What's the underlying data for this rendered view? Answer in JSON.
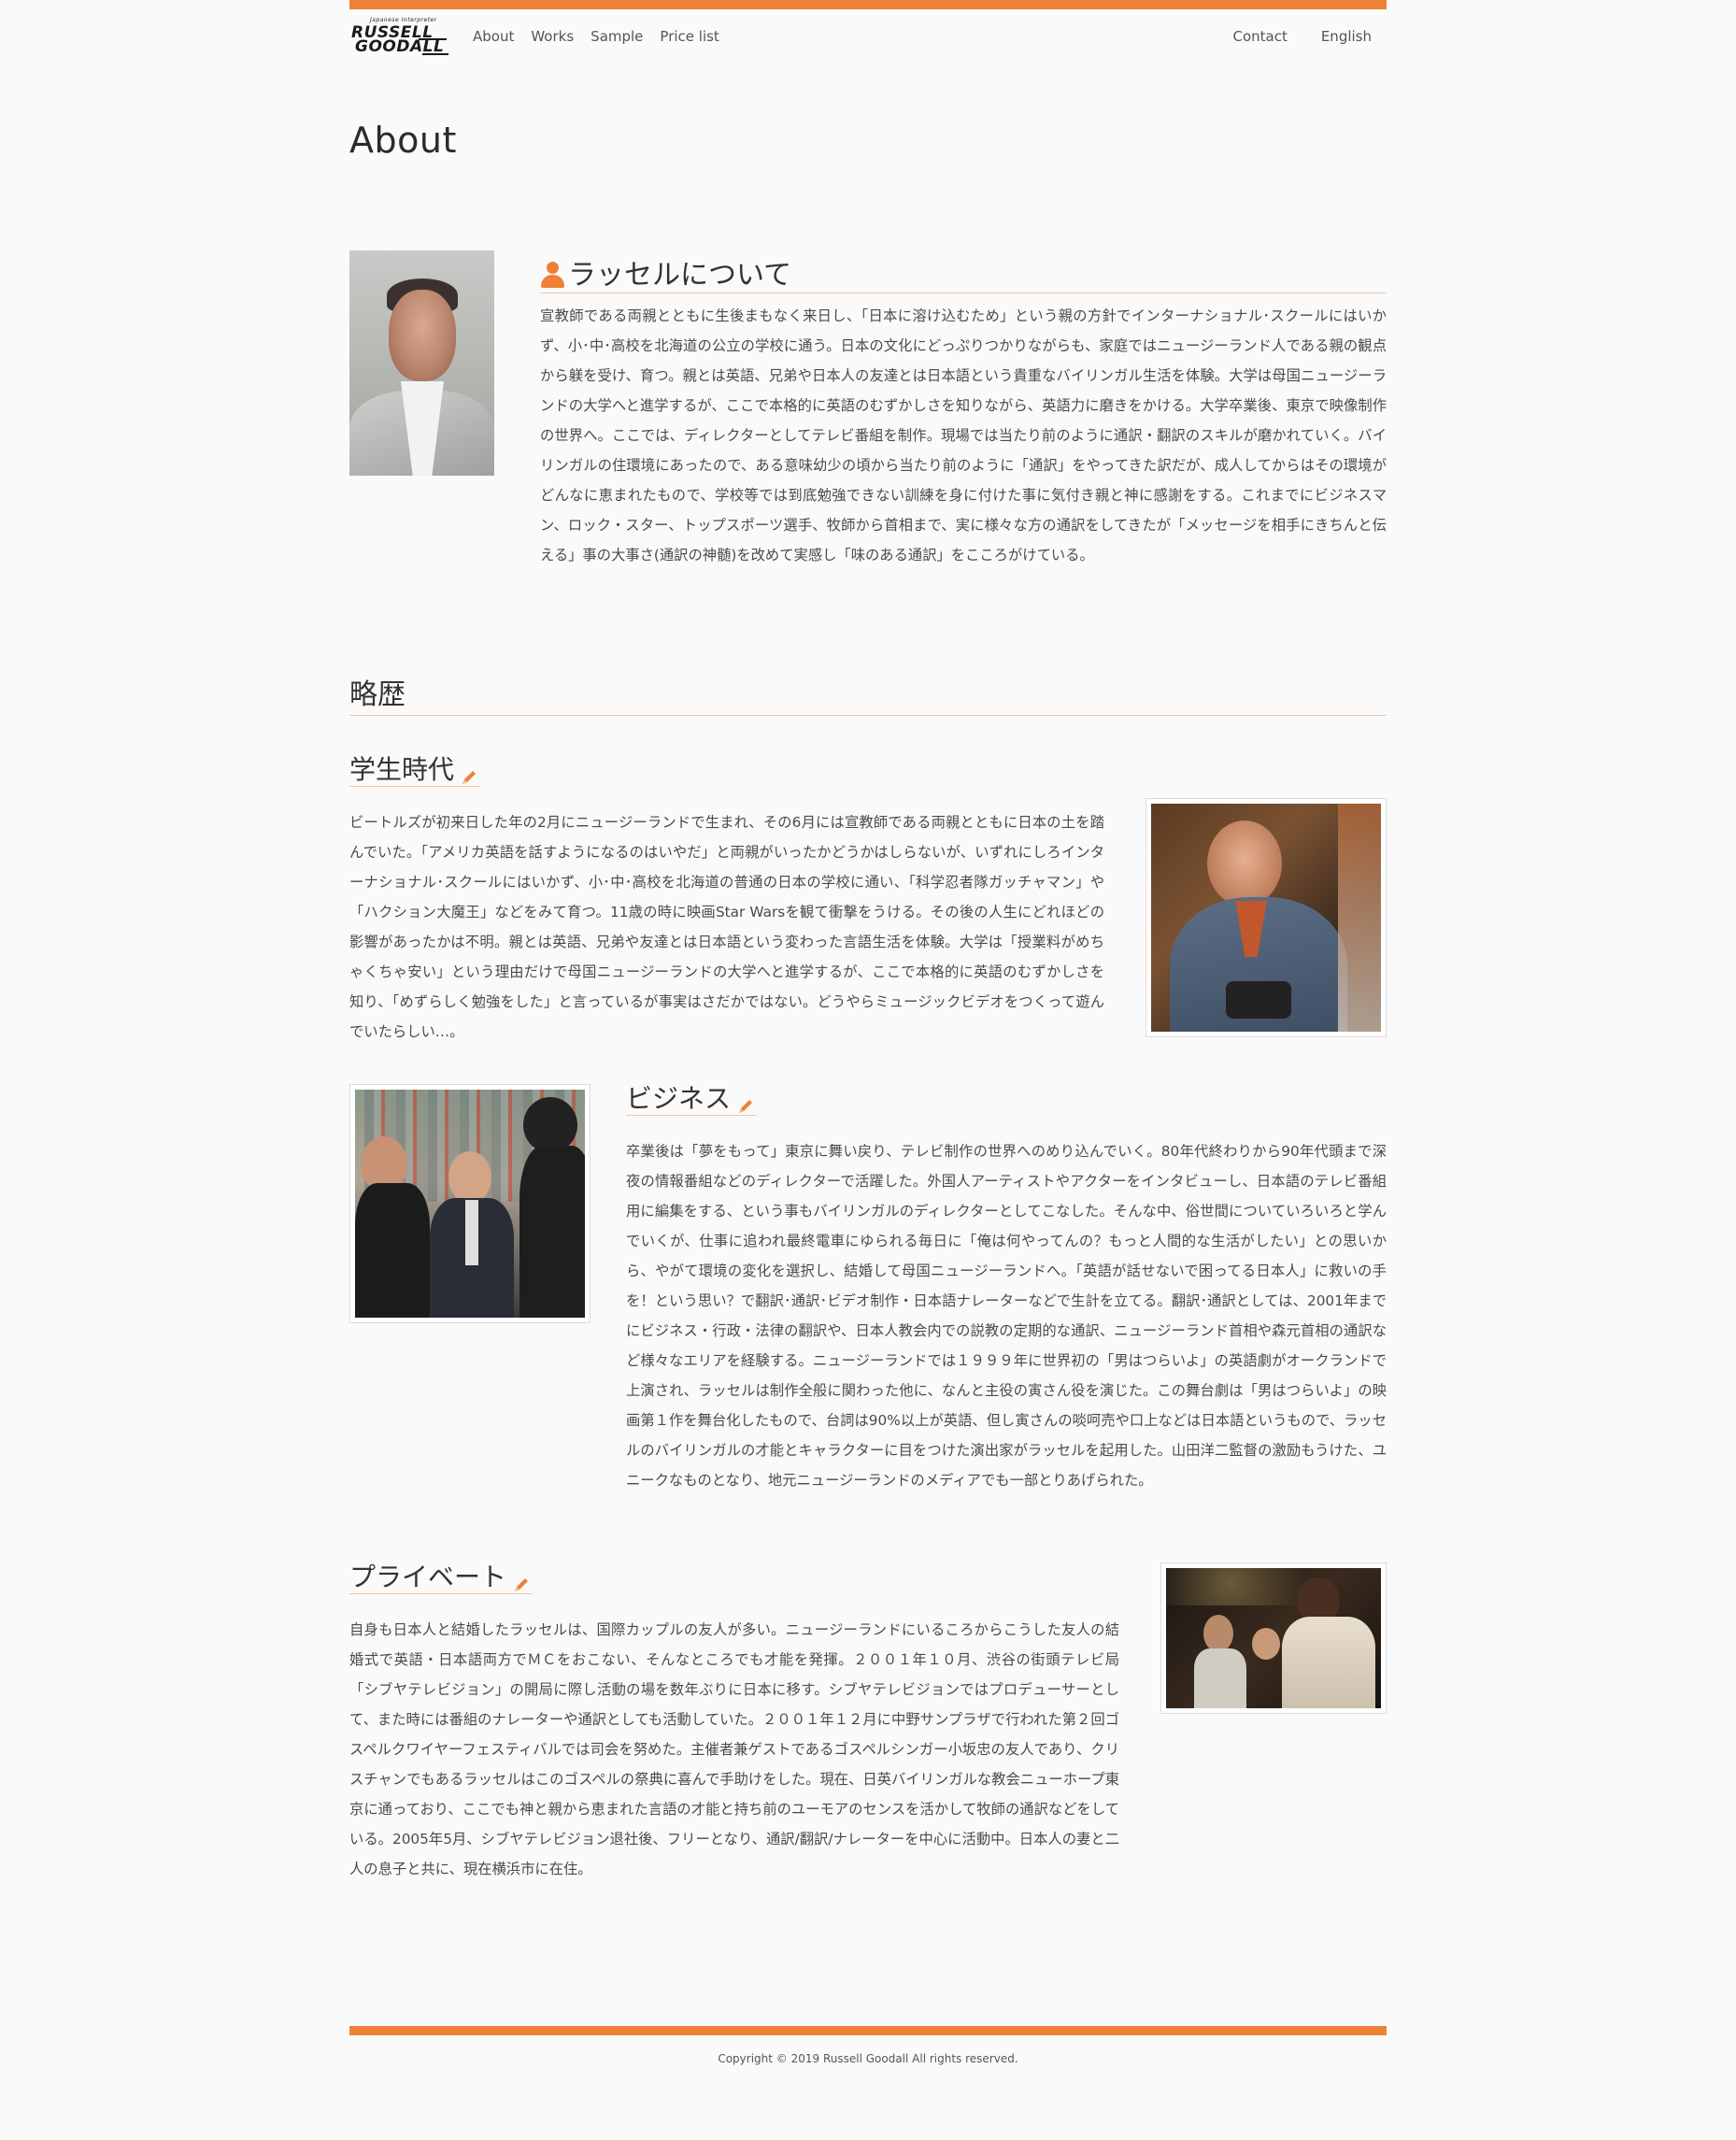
{
  "header": {
    "logo_tagline": "Japanese Interpreter",
    "logo_line1": "RUSSELL",
    "logo_line2": "GOODALL",
    "nav": [
      "About",
      "Works",
      "Sample",
      "Price list"
    ],
    "nav_right": [
      "Contact",
      "English"
    ]
  },
  "page_title": "About",
  "about": {
    "heading": "ラッセルについて",
    "text": "宣教師である両親とともに生後まもなく来日し、「日本に溶け込むため」という親の方針でインターナショナル･スクールにはいかず、小･中･高校を北海道の公立の学校に通う。日本の文化にどっぷりつかりながらも、家庭ではニュージーランド人である親の観点から躾を受け、育つ。親とは英語、兄弟や日本人の友達とは日本語という貴重なバイリンガル生活を体験。大学は母国ニュージーランドの大学へと進学するが、ここで本格的に英語のむずかしさを知りながら、英語力に磨きをかける。大学卒業後、東京で映像制作の世界へ。ここでは、ディレクターとしてテレビ番組を制作。現場では当たり前のように通訳・翻訳のスキルが磨かれていく。バイリンガルの住環境にあったので、ある意味幼少の頃から当たり前のように「通訳」をやってきた訳だが、成人してからはその環境がどんなに恵まれたもので、学校等では到底勉強できない訓練を身に付けた事に気付き親と神に感謝をする。これまでにビジネスマン、ロック・スター、トップスポーツ選手、牧師から首相まで、実に様々な方の通訳をしてきたが「メッセージを相手にきちんと伝える」事の大事さ(通訳の神髄)を改めて実感し「味のある通訳」をこころがけている。"
  },
  "history": {
    "heading": "略歴",
    "student": {
      "heading": "学生時代",
      "text": "ビートルズが初来日した年の2月にニュージーランドで生まれ、その6月には宣教師である両親とともに日本の土を踏んでいた。「アメリカ英語を話すようになるのはいやだ」と両親がいったかどうかはしらないが、いずれにしろインターナショナル･スクールにはいかず、小･中･高校を北海道の普通の日本の学校に通い、「科学忍者隊ガッチャマン」や「ハクション大魔王」などをみて育つ。11歳の時に映画Star Warsを観て衝撃をうける。その後の人生にどれほどの影響があったかは不明。親とは英語、兄弟や友達とは日本語という変わった言語生活を体験。大学は「授業料がめちゃくちゃ安い」という理由だけで母国ニュージーランドの大学へと進学するが、ここで本格的に英語のむずかしさを知り、「めずらしく勉強をした」と言っているが事実はさだかではない。どうやらミュージックビデオをつくって遊んでいたらしい…。"
    },
    "business": {
      "heading": "ビジネス",
      "text": "卒業後は「夢をもって」東京に舞い戻り、テレビ制作の世界へのめり込んでいく。80年代終わりから90年代頭まで深夜の情報番組などのディレクターで活躍した。外国人アーティストやアクターをインタビューし、日本語のテレビ番組用に編集をする、という事もバイリンガルのディレクターとしてこなした。そんな中、俗世間についていろいろと学んでいくが、仕事に追われ最終電車にゆられる毎日に「俺は何やってんの？もっと人間的な生活がしたい」との思いから、やがて環境の変化を選択し、結婚して母国ニュージーランドへ。「英語が話せないで困ってる日本人」に救いの手を！という思い？で翻訳･通訳･ビデオ制作・日本語ナレーターなどで生計を立てる。翻訳･通訳としては、2001年までにビジネス・行政・法律の翻訳や、日本人教会内での説教の定期的な通訳、ニュージーランド首相や森元首相の通訳など様々なエリアを経験する。ニュージーランドでは１９９９年に世界初の「男はつらいよ」の英語劇がオークランドで上演され、ラッセルは制作全般に関わった他に、なんと主役の寅さん役を演じた。この舞台劇は「男はつらいよ」の映画第１作を舞台化したもので、台詞は90%以上が英語、但し寅さんの啖呵売や口上などは日本語というもので、ラッセルのバイリンガルの才能とキャラクターに目をつけた演出家がラッセルを起用した。山田洋二監督の激励もうけた、ユニークなものとなり、地元ニュージーランドのメディアでも一部とりあげられた。"
    },
    "private": {
      "heading": "プライベート",
      "text": "自身も日本人と結婚したラッセルは、国際カップルの友人が多い。ニュージーランドにいるころからこうした友人の結婚式で英語・日本語両方でＭＣをおこない、そんなところでも才能を発揮。２００１年１０月、渋谷の街頭テレビ局「シブヤテレビジョン」の開局に際し活動の場を数年ぶりに日本に移す。シブヤテレビジョンではプロデューサーとして、また時には番組のナレーターや通訳としても活動していた。２００１年１２月に中野サンプラザで行われた第２回ゴスペルクワイヤーフェスティバルでは司会を努めた。主催者兼ゲストであるゴスペルシンガー小坂忠の友人であり、クリスチャンでもあるラッセルはこのゴスペルの祭典に喜んで手助けをした。現在、日英バイリンガルな教会ニューホープ東京に通っており、ここでも神と親から恵まれた言語の才能と持ち前のユーモアのセンスを活かして牧師の通訳などをしている。2005年5月、シブヤテレビジョン退社後、フリーとなり、通訳/翻訳/ナレーターを中心に活動中。日本人の妻と二人の息子と共に、現在横浜市に在住。"
    }
  },
  "footer": {
    "copyright": "Copyright © 2019 Russell Goodall All rights reserved."
  },
  "colors": {
    "accent": "#ef8136",
    "divider": "#f5c3a0",
    "background": "#fafafa"
  }
}
